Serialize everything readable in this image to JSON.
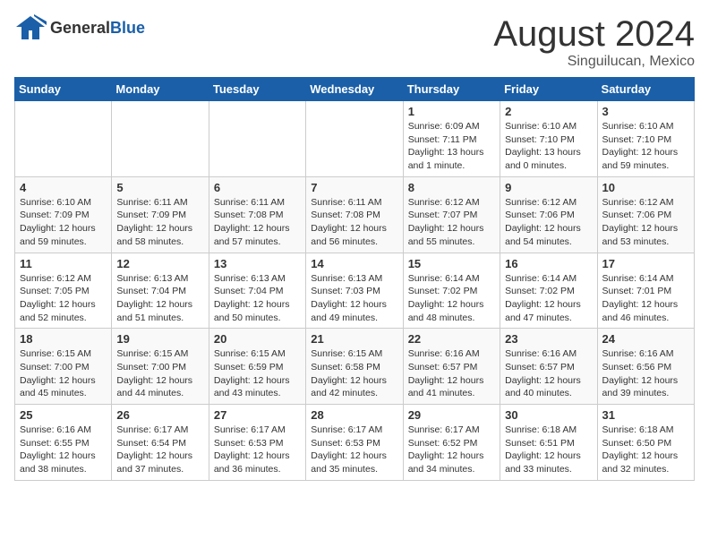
{
  "header": {
    "logo_general": "General",
    "logo_blue": "Blue",
    "month_year": "August 2024",
    "location": "Singuilucan, Mexico"
  },
  "weekdays": [
    "Sunday",
    "Monday",
    "Tuesday",
    "Wednesday",
    "Thursday",
    "Friday",
    "Saturday"
  ],
  "weeks": [
    [
      {
        "day": "",
        "info": ""
      },
      {
        "day": "",
        "info": ""
      },
      {
        "day": "",
        "info": ""
      },
      {
        "day": "",
        "info": ""
      },
      {
        "day": "1",
        "info": "Sunrise: 6:09 AM\nSunset: 7:11 PM\nDaylight: 13 hours\nand 1 minute."
      },
      {
        "day": "2",
        "info": "Sunrise: 6:10 AM\nSunset: 7:10 PM\nDaylight: 13 hours\nand 0 minutes."
      },
      {
        "day": "3",
        "info": "Sunrise: 6:10 AM\nSunset: 7:10 PM\nDaylight: 12 hours\nand 59 minutes."
      }
    ],
    [
      {
        "day": "4",
        "info": "Sunrise: 6:10 AM\nSunset: 7:09 PM\nDaylight: 12 hours\nand 59 minutes."
      },
      {
        "day": "5",
        "info": "Sunrise: 6:11 AM\nSunset: 7:09 PM\nDaylight: 12 hours\nand 58 minutes."
      },
      {
        "day": "6",
        "info": "Sunrise: 6:11 AM\nSunset: 7:08 PM\nDaylight: 12 hours\nand 57 minutes."
      },
      {
        "day": "7",
        "info": "Sunrise: 6:11 AM\nSunset: 7:08 PM\nDaylight: 12 hours\nand 56 minutes."
      },
      {
        "day": "8",
        "info": "Sunrise: 6:12 AM\nSunset: 7:07 PM\nDaylight: 12 hours\nand 55 minutes."
      },
      {
        "day": "9",
        "info": "Sunrise: 6:12 AM\nSunset: 7:06 PM\nDaylight: 12 hours\nand 54 minutes."
      },
      {
        "day": "10",
        "info": "Sunrise: 6:12 AM\nSunset: 7:06 PM\nDaylight: 12 hours\nand 53 minutes."
      }
    ],
    [
      {
        "day": "11",
        "info": "Sunrise: 6:12 AM\nSunset: 7:05 PM\nDaylight: 12 hours\nand 52 minutes."
      },
      {
        "day": "12",
        "info": "Sunrise: 6:13 AM\nSunset: 7:04 PM\nDaylight: 12 hours\nand 51 minutes."
      },
      {
        "day": "13",
        "info": "Sunrise: 6:13 AM\nSunset: 7:04 PM\nDaylight: 12 hours\nand 50 minutes."
      },
      {
        "day": "14",
        "info": "Sunrise: 6:13 AM\nSunset: 7:03 PM\nDaylight: 12 hours\nand 49 minutes."
      },
      {
        "day": "15",
        "info": "Sunrise: 6:14 AM\nSunset: 7:02 PM\nDaylight: 12 hours\nand 48 minutes."
      },
      {
        "day": "16",
        "info": "Sunrise: 6:14 AM\nSunset: 7:02 PM\nDaylight: 12 hours\nand 47 minutes."
      },
      {
        "day": "17",
        "info": "Sunrise: 6:14 AM\nSunset: 7:01 PM\nDaylight: 12 hours\nand 46 minutes."
      }
    ],
    [
      {
        "day": "18",
        "info": "Sunrise: 6:15 AM\nSunset: 7:00 PM\nDaylight: 12 hours\nand 45 minutes."
      },
      {
        "day": "19",
        "info": "Sunrise: 6:15 AM\nSunset: 7:00 PM\nDaylight: 12 hours\nand 44 minutes."
      },
      {
        "day": "20",
        "info": "Sunrise: 6:15 AM\nSunset: 6:59 PM\nDaylight: 12 hours\nand 43 minutes."
      },
      {
        "day": "21",
        "info": "Sunrise: 6:15 AM\nSunset: 6:58 PM\nDaylight: 12 hours\nand 42 minutes."
      },
      {
        "day": "22",
        "info": "Sunrise: 6:16 AM\nSunset: 6:57 PM\nDaylight: 12 hours\nand 41 minutes."
      },
      {
        "day": "23",
        "info": "Sunrise: 6:16 AM\nSunset: 6:57 PM\nDaylight: 12 hours\nand 40 minutes."
      },
      {
        "day": "24",
        "info": "Sunrise: 6:16 AM\nSunset: 6:56 PM\nDaylight: 12 hours\nand 39 minutes."
      }
    ],
    [
      {
        "day": "25",
        "info": "Sunrise: 6:16 AM\nSunset: 6:55 PM\nDaylight: 12 hours\nand 38 minutes."
      },
      {
        "day": "26",
        "info": "Sunrise: 6:17 AM\nSunset: 6:54 PM\nDaylight: 12 hours\nand 37 minutes."
      },
      {
        "day": "27",
        "info": "Sunrise: 6:17 AM\nSunset: 6:53 PM\nDaylight: 12 hours\nand 36 minutes."
      },
      {
        "day": "28",
        "info": "Sunrise: 6:17 AM\nSunset: 6:53 PM\nDaylight: 12 hours\nand 35 minutes."
      },
      {
        "day": "29",
        "info": "Sunrise: 6:17 AM\nSunset: 6:52 PM\nDaylight: 12 hours\nand 34 minutes."
      },
      {
        "day": "30",
        "info": "Sunrise: 6:18 AM\nSunset: 6:51 PM\nDaylight: 12 hours\nand 33 minutes."
      },
      {
        "day": "31",
        "info": "Sunrise: 6:18 AM\nSunset: 6:50 PM\nDaylight: 12 hours\nand 32 minutes."
      }
    ]
  ]
}
